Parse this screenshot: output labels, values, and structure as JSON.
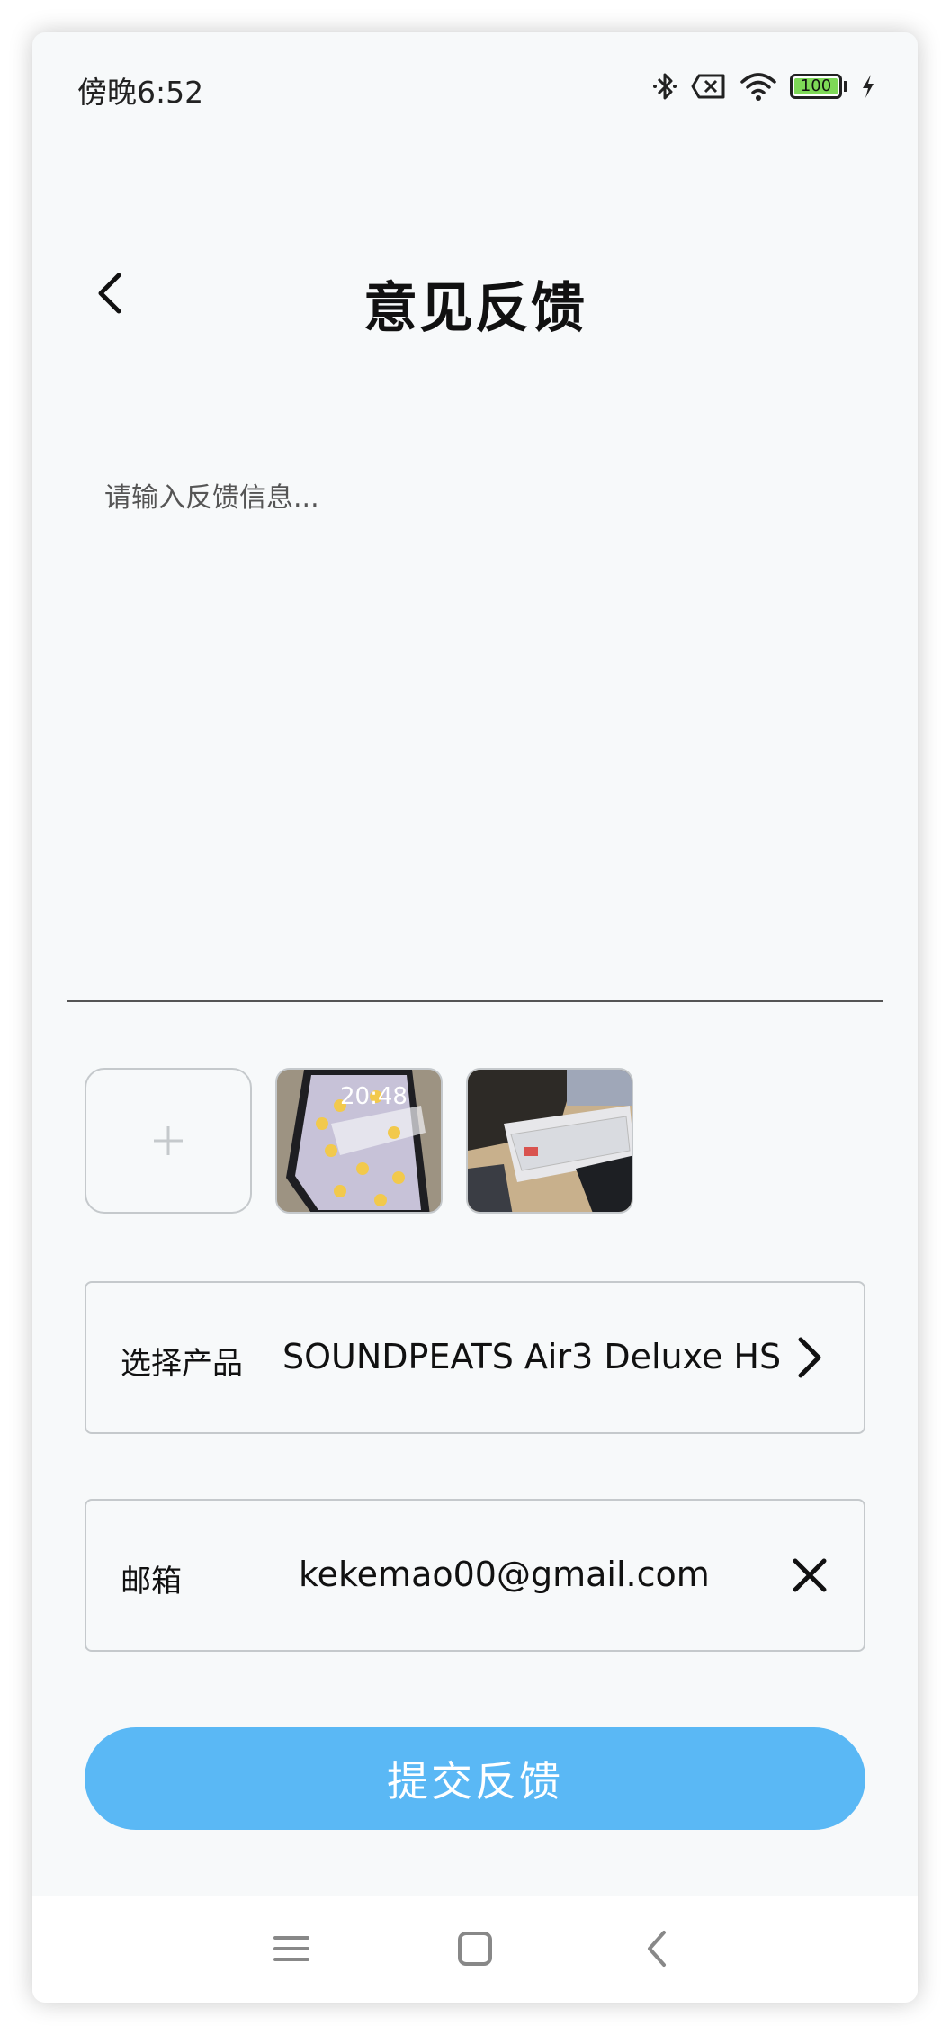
{
  "status_bar": {
    "time": "傍晚6:52",
    "battery": "100",
    "icons": [
      "bluetooth-icon",
      "no-sim-icon",
      "wifi-icon",
      "battery-icon",
      "charging-icon"
    ]
  },
  "header": {
    "title": "意见反馈",
    "back_icon": "chevron-left-icon"
  },
  "feedback": {
    "placeholder": "请输入反馈信息...",
    "value": ""
  },
  "images": {
    "add_label": "+",
    "thumbnails": [
      "phone-screen-photo",
      "keyboard-desk-photo"
    ],
    "thumbnail_overlay_text": "20:48"
  },
  "product": {
    "label": "选择产品",
    "value": "SOUNDPEATS Air3 Deluxe HS",
    "icon": "chevron-right-icon"
  },
  "email": {
    "label": "邮箱",
    "value": "kekemao00@gmail.com",
    "icon": "clear-icon"
  },
  "submit": {
    "label": "提交反馈",
    "color": "#5ab8f5"
  },
  "nav_bar": {
    "icons": [
      "menu-icon",
      "home-icon",
      "back-icon"
    ]
  }
}
